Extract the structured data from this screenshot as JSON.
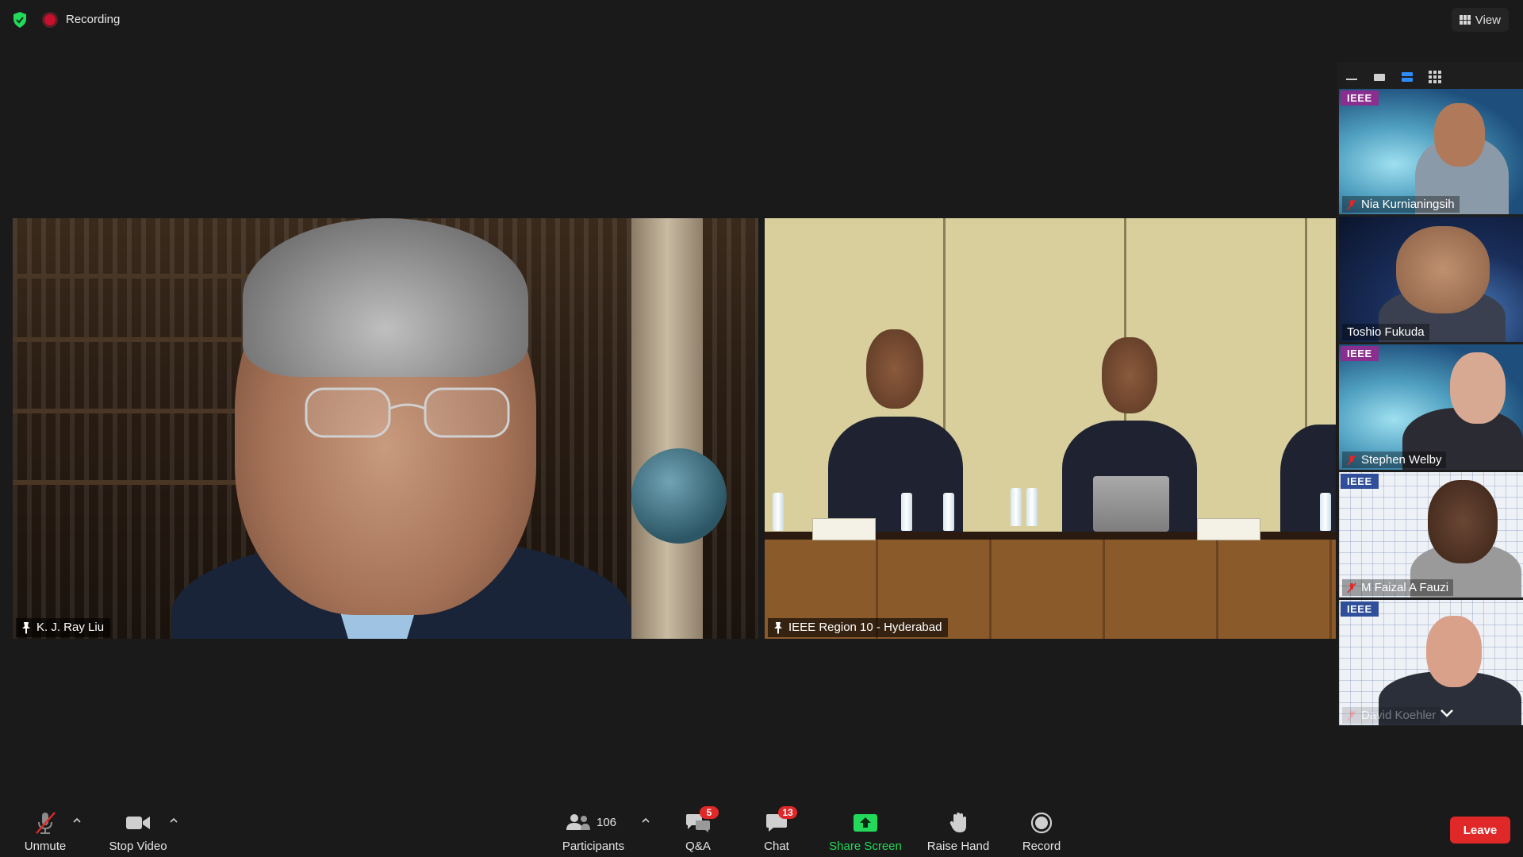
{
  "topbar": {
    "recording_label": "Recording",
    "view_label": "View"
  },
  "main_tiles": [
    {
      "name": "K. J. Ray Liu"
    },
    {
      "name": "IEEE Region 10 - Hyderabad"
    }
  ],
  "sidebar": {
    "thumbnails": [
      {
        "name": "Nia Kurnianingsih",
        "muted": true,
        "logo": "IEEE"
      },
      {
        "name": "Toshio Fukuda",
        "muted": false,
        "logo": ""
      },
      {
        "name": "Stephen Welby",
        "muted": true,
        "logo": "IEEE"
      },
      {
        "name": "M Faizal A Fauzi",
        "muted": true,
        "logo": "IEEE"
      },
      {
        "name": "David Koehler",
        "muted": true,
        "logo": "IEEE"
      }
    ]
  },
  "toolbar": {
    "unmute": "Unmute",
    "stop_video": "Stop Video",
    "participants": "Participants",
    "participants_count": "106",
    "qa": "Q&A",
    "qa_badge": "5",
    "chat": "Chat",
    "chat_badge": "13",
    "share_screen": "Share Screen",
    "raise_hand": "Raise Hand",
    "record": "Record",
    "leave": "Leave"
  },
  "colors": {
    "background": "#1a1a1a",
    "share_green": "#23d959",
    "leave_red": "#e02828",
    "ieee_purple": "#8a2f8f",
    "active_layout_blue": "#2d8cff"
  }
}
